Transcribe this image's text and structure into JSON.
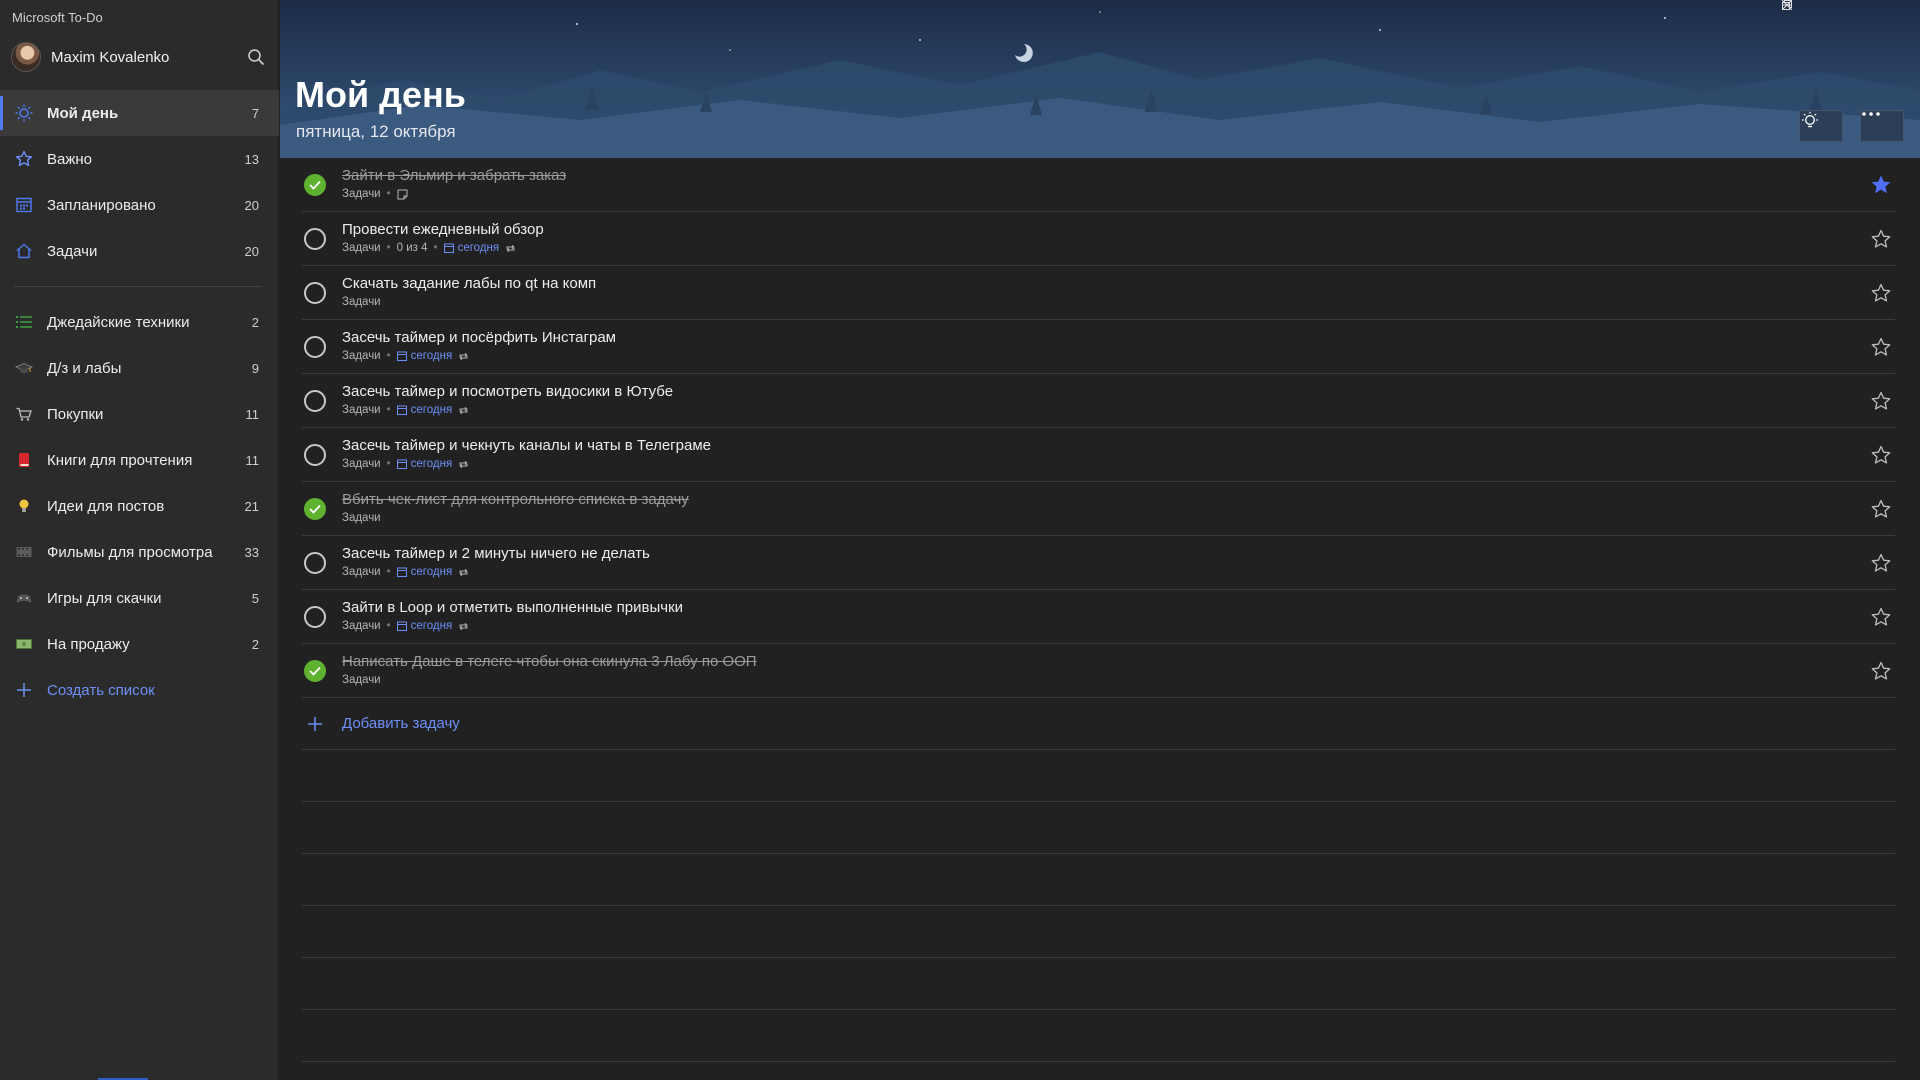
{
  "app": {
    "title": "Microsoft To-Do"
  },
  "user": {
    "name": "Maxim Kovalenko"
  },
  "colors": {
    "accent": "#4f7cf5",
    "done": "#5fb130",
    "link": "#6e8ff7"
  },
  "sidebar": {
    "smart_lists": [
      {
        "label": "Мой день",
        "count": "7",
        "icon": "sun-icon"
      },
      {
        "label": "Важно",
        "count": "13",
        "icon": "star-icon"
      },
      {
        "label": "Запланировано",
        "count": "20",
        "icon": "calendar-icon"
      },
      {
        "label": "Задачи",
        "count": "20",
        "icon": "home-icon"
      }
    ],
    "lists": [
      {
        "label": "Джедайские техники",
        "count": "2",
        "icon": "checklist-icon"
      },
      {
        "label": "Д/з и лабы",
        "count": "9",
        "icon": "graduation-cap-icon"
      },
      {
        "label": "Покупки",
        "count": "11",
        "icon": "cart-icon"
      },
      {
        "label": "Книги для прочтения",
        "count": "11",
        "icon": "book-icon"
      },
      {
        "label": "Идеи для постов",
        "count": "21",
        "icon": "lightbulb-icon"
      },
      {
        "label": "Фильмы для просмотра",
        "count": "33",
        "icon": "film-icon"
      },
      {
        "label": "Игры для скачки",
        "count": "5",
        "icon": "gamepad-icon"
      },
      {
        "label": "На продажу",
        "count": "2",
        "icon": "money-icon"
      }
    ],
    "create_list": "Создать список"
  },
  "main": {
    "title": "Мой день",
    "date": "пятница, 12 октября",
    "tasks": [
      {
        "title": "Зайти в Эльмир и забрать заказ",
        "list": "Задачи",
        "done": true,
        "important": true,
        "note": true
      },
      {
        "title": "Провести ежедневный обзор",
        "list": "Задачи",
        "steps": "0 из 4",
        "due": "сегодня",
        "repeat": true,
        "done": false,
        "important": false
      },
      {
        "title": "Скачать задание лабы по qt на комп",
        "list": "Задачи",
        "done": false,
        "important": false
      },
      {
        "title": "Засечь таймер и посёрфить Инстаграм",
        "list": "Задачи",
        "due": "сегодня",
        "repeat": true,
        "done": false,
        "important": false
      },
      {
        "title": "Засечь таймер и посмотреть видосики в Ютубе",
        "list": "Задачи",
        "due": "сегодня",
        "repeat": true,
        "done": false,
        "important": false
      },
      {
        "title": "Засечь таймер и чекнуть каналы и чаты в Телеграме",
        "list": "Задачи",
        "due": "сегодня",
        "repeat": true,
        "done": false,
        "important": false
      },
      {
        "title": "Вбить чек-лист для контрольного списка в задачу",
        "list": "Задачи",
        "done": true,
        "important": false
      },
      {
        "title": "Засечь таймер и 2 минуты ничего не делать",
        "list": "Задачи",
        "due": "сегодня",
        "repeat": true,
        "done": false,
        "important": false
      },
      {
        "title": "Зайти в Loop и отметить выполненные привычки",
        "list": "Задачи",
        "due": "сегодня",
        "repeat": true,
        "done": false,
        "important": false
      },
      {
        "title": "Написать Даше в телеге чтобы она скинула 3 Лабу по ООП",
        "list": "Задачи",
        "done": true,
        "important": false
      }
    ],
    "add_task": "Добавить задачу"
  }
}
